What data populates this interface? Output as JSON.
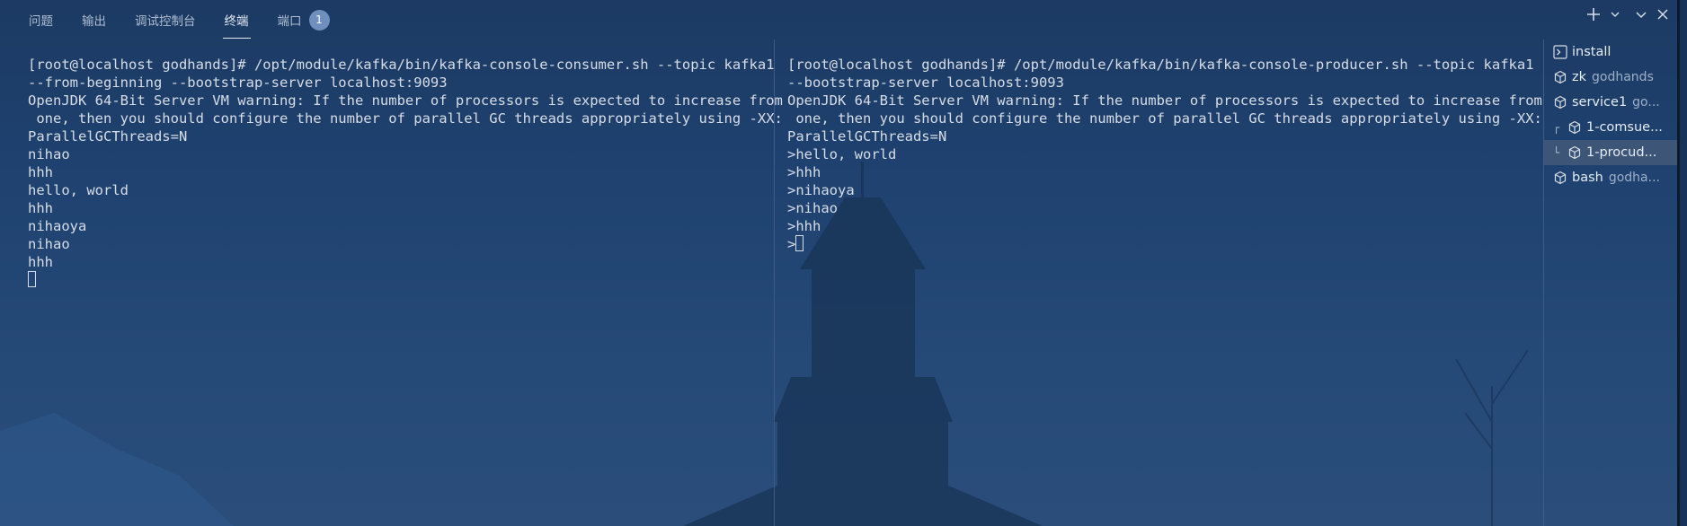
{
  "panel_tabs": [
    {
      "label": "问题",
      "active": false
    },
    {
      "label": "输出",
      "active": false
    },
    {
      "label": "调试控制台",
      "active": false
    },
    {
      "label": "终端",
      "active": true
    },
    {
      "label": "端口",
      "active": false
    }
  ],
  "ports_badge": "1",
  "left_terminal": {
    "lines": [
      "[root@localhost godhands]# /opt/module/kafka/bin/kafka-console-consumer.sh --topic kafka1",
      "--from-beginning --bootstrap-server localhost:9093",
      "OpenJDK 64-Bit Server VM warning: If the number of processors is expected to increase from",
      " one, then you should configure the number of parallel GC threads appropriately using -XX:",
      "ParallelGCThreads=N",
      "nihao",
      "hhh",
      "hello, world",
      "hhh",
      "nihaoya",
      "nihao",
      "hhh"
    ]
  },
  "right_terminal": {
    "lines": [
      "[root@localhost godhands]# /opt/module/kafka/bin/kafka-console-producer.sh --topic kafka1",
      "--bootstrap-server localhost:9093",
      "OpenJDK 64-Bit Server VM warning: If the number of processors is expected to increase from",
      " one, then you should configure the number of parallel GC threads appropriately using -XX:",
      "ParallelGCThreads=N",
      ">hello, world",
      ">hhh",
      ">nihaoya",
      ">nihao",
      ">hhh"
    ],
    "prompt": ">"
  },
  "terminal_list": [
    {
      "name": "install",
      "desc": "",
      "icon": "terminal-icon",
      "tree": "",
      "selected": false
    },
    {
      "name": "zk",
      "desc": "godhands",
      "icon": "cube-icon",
      "tree": "",
      "selected": false
    },
    {
      "name": "service1",
      "desc": "go...",
      "icon": "cube-icon",
      "tree": "",
      "selected": false
    },
    {
      "name": "1-comsue...",
      "desc": "",
      "icon": "cube-icon",
      "tree": "┌",
      "selected": false
    },
    {
      "name": "1-procud...",
      "desc": "",
      "icon": "cube-icon",
      "tree": "└",
      "selected": true
    },
    {
      "name": "bash",
      "desc": "godha...",
      "icon": "cube-icon",
      "tree": "",
      "selected": false
    }
  ],
  "actions": [
    "plus-icon",
    "chevron-down-icon",
    "chevron-down-icon",
    "close-icon"
  ],
  "colors": {
    "background": "#1f4271",
    "text": "#d7dde6",
    "selected_item": "#3d5677",
    "badge": "#6f8fbf"
  }
}
